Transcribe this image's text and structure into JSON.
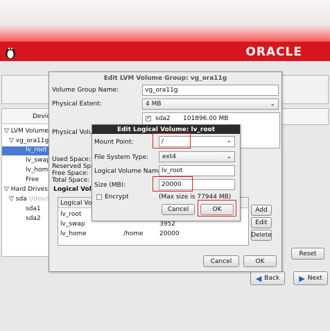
{
  "brand": "ORACLE",
  "background": {
    "device_header": "Devic",
    "tree": [
      {
        "label": "LVM Volume G",
        "indent": 0,
        "prefix": "▽"
      },
      {
        "label": "vg_ora11g",
        "indent": 1,
        "prefix": "▽"
      },
      {
        "label": "lv_root",
        "indent": 2,
        "prefix": "",
        "selected": true
      },
      {
        "label": "lv_swap",
        "indent": 2,
        "prefix": ""
      },
      {
        "label": "lv_home",
        "indent": 2,
        "prefix": ""
      },
      {
        "label": "Free",
        "indent": 2,
        "prefix": ""
      },
      {
        "label": "Hard Drives",
        "indent": 0,
        "prefix": "▽"
      },
      {
        "label": "sda",
        "indent": 1,
        "prefix": "▽"
      },
      {
        "label": "sda1",
        "indent": 2,
        "prefix": ""
      },
      {
        "label": "sda2",
        "indent": 2,
        "prefix": ""
      }
    ],
    "sda_faded": "(/dev/sda",
    "reset_label": "Reset",
    "back_label": "Back",
    "next_label": "Next"
  },
  "vg_dialog": {
    "title": "Edit LVM Volume Group: vg_ora11g",
    "vg_name_label": "Volume Group Name:",
    "vg_name_value": "vg_ora11g",
    "pe_label": "Physical Extent:",
    "pe_value": "4 MB",
    "pv_label": "Physical Volum",
    "pv_rows": [
      {
        "device": "sda2",
        "size": "101896.00 MB"
      }
    ],
    "used_label": "Used Space:",
    "reserved_label": "Reserved Spac",
    "free_label": "Free Space:",
    "total_label": "Total Space:",
    "lv_section_label": "Logical Volu",
    "lv_header": "Logical Volu",
    "lv_rows": [
      {
        "name": "lv_root",
        "mount": "",
        "size": ""
      },
      {
        "name": "lv_swap",
        "mount": "",
        "size": "3952"
      },
      {
        "name": "lv_home",
        "mount": "/home",
        "size": "20000"
      }
    ],
    "add_label": "Add",
    "edit_label": "Edit",
    "delete_label": "Delete",
    "cancel_label": "Cancel",
    "ok_label": "OK"
  },
  "lv_dialog": {
    "title": "Edit Logical Volume: lv_root",
    "mount_label": "Mount Point:",
    "mount_value": "/",
    "fs_label": "File System Type:",
    "fs_value": "ext4",
    "lv_name_label": "Logical Volume Name:",
    "lv_name_value": "lv_root",
    "size_label": "Size (MB):",
    "size_value": "20000",
    "encrypt_label": "Encrypt",
    "max_size_note": "(Max size is 77944 MB)",
    "cancel_label": "Cancel",
    "ok_label": "OK"
  },
  "colors": {
    "oracle_red": "#d6161e",
    "highlight": "#e02020",
    "selection": "#4a7bd0"
  }
}
